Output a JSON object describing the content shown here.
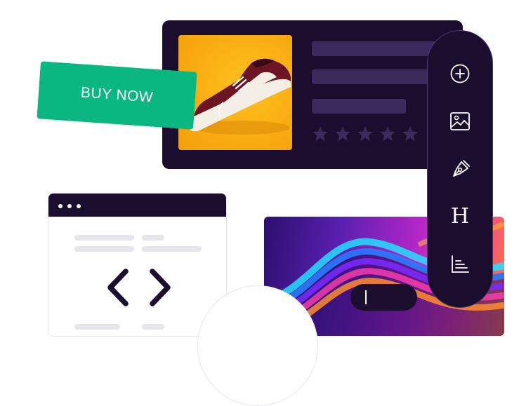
{
  "buy_tag": {
    "label": "BUY NOW"
  },
  "product": {
    "rating_stars": 5
  },
  "toolbar": {
    "items": [
      {
        "name": "add-icon"
      },
      {
        "name": "image-icon"
      },
      {
        "name": "pen-icon"
      },
      {
        "name": "heading-icon",
        "glyph": "H"
      },
      {
        "name": "chart-icon"
      }
    ]
  },
  "code_window": {
    "dots": 3
  },
  "colors": {
    "dark": "#1a0d2e",
    "accent_green": "#0bb780",
    "placeholder": "#3d2a5c",
    "shoe_bg": "#f9ad12"
  }
}
